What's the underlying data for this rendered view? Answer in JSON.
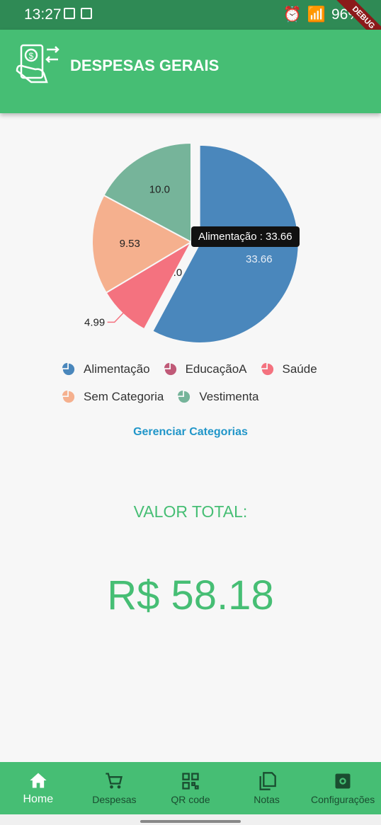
{
  "status": {
    "time": "13:27",
    "battery": "96%",
    "debug": "DEBUG"
  },
  "header": {
    "title": "DESPESAS GERAIS",
    "logo": "money-transfer-icon"
  },
  "chart_data": {
    "type": "pie",
    "slices": [
      {
        "name": "Alimentação",
        "value": 33.66,
        "label": "33.66",
        "color": "#4a87bc"
      },
      {
        "name": "EducaçãoA",
        "value": 0.0,
        "label": "0.0",
        "color": "#c05a78"
      },
      {
        "name": "Saúde",
        "value": 4.99,
        "label": "4.99",
        "color": "#f4727f"
      },
      {
        "name": "Sem Categoria",
        "value": 9.53,
        "label": "9.53",
        "color": "#f5b08e"
      },
      {
        "name": "Vestimenta",
        "value": 10.0,
        "label": "10.0",
        "color": "#76b49a"
      }
    ]
  },
  "tooltip": {
    "text": "Alimentação : 33.66"
  },
  "legend": [
    {
      "label": "Alimentação",
      "color": "#4a87bc"
    },
    {
      "label": "EducaçãoA",
      "color": "#c05a78"
    },
    {
      "label": "Saúde",
      "color": "#f4727f"
    },
    {
      "label": "Sem Categoria",
      "color": "#f5b08e"
    },
    {
      "label": "Vestimenta",
      "color": "#76b49a"
    }
  ],
  "manage_link": "Gerenciar Categorias",
  "total": {
    "label": "VALOR TOTAL:",
    "value": "R$ 58.18"
  },
  "nav": [
    {
      "label": "Home",
      "icon": "home-icon",
      "active": true
    },
    {
      "label": "Despesas",
      "icon": "cart-icon",
      "active": false
    },
    {
      "label": "QR code",
      "icon": "qr-code-icon",
      "active": false
    },
    {
      "label": "Notas",
      "icon": "copy-icon",
      "active": false
    },
    {
      "label": "Configurações",
      "icon": "settings-icon",
      "active": false
    }
  ]
}
